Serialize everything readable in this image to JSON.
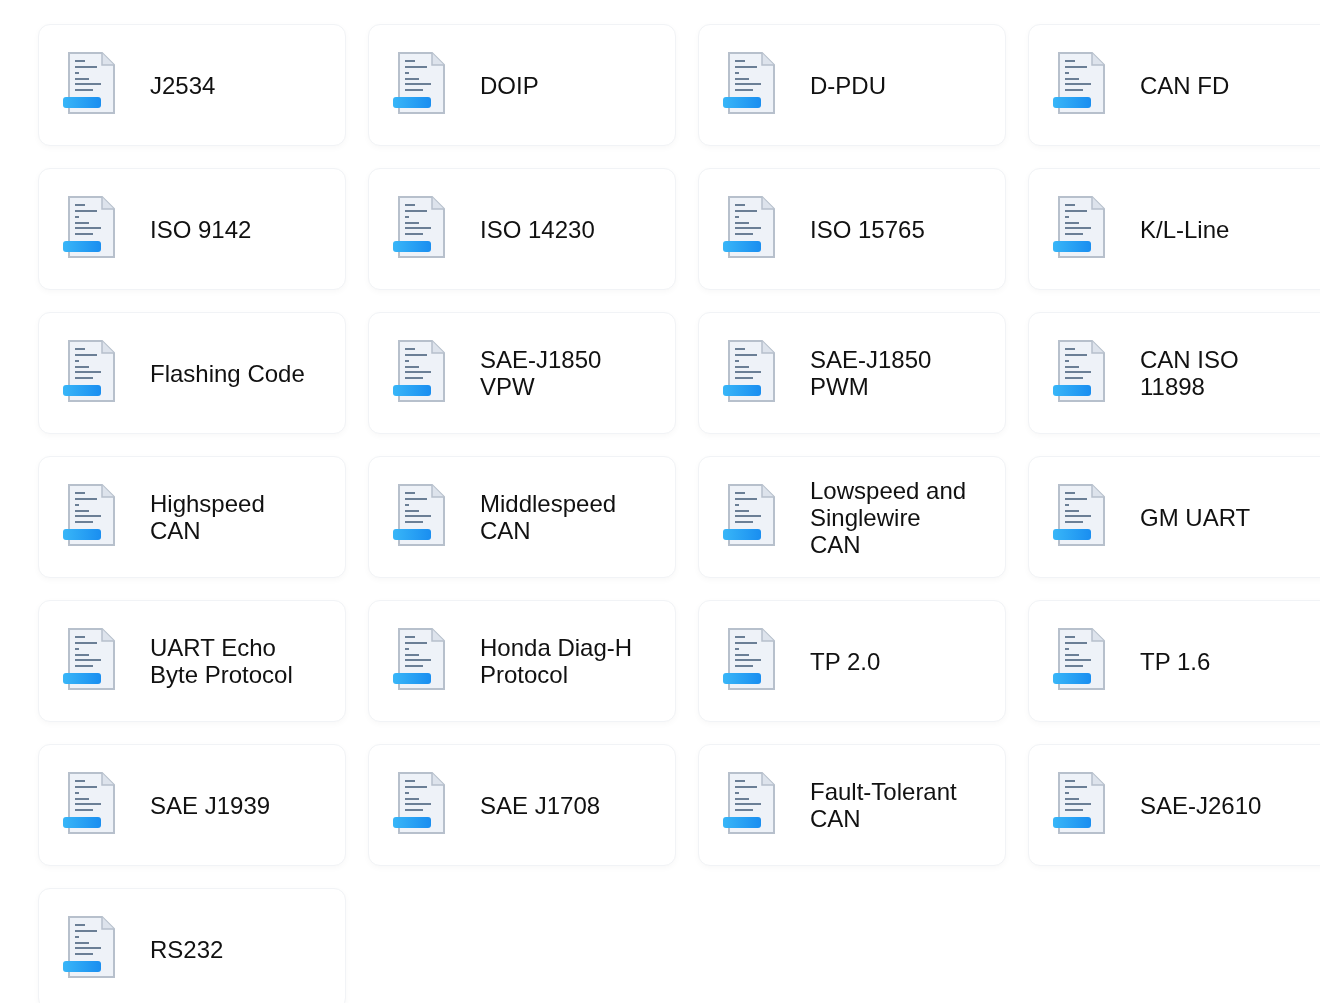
{
  "cards": [
    {
      "lines": [
        "J2534"
      ]
    },
    {
      "lines": [
        "DOIP"
      ]
    },
    {
      "lines": [
        "D-PDU"
      ]
    },
    {
      "lines": [
        "CAN FD"
      ]
    },
    {
      "lines": [
        "ISO 9142"
      ]
    },
    {
      "lines": [
        "ISO 14230"
      ]
    },
    {
      "lines": [
        "ISO 15765"
      ]
    },
    {
      "lines": [
        "K/L-Line"
      ]
    },
    {
      "lines": [
        "Flashing Code"
      ]
    },
    {
      "lines": [
        "SAE-J1850",
        "VPW"
      ]
    },
    {
      "lines": [
        "SAE-J1850",
        "PWM"
      ]
    },
    {
      "lines": [
        "CAN ISO",
        "11898"
      ]
    },
    {
      "lines": [
        "Highspeed",
        "CAN"
      ]
    },
    {
      "lines": [
        "Middlespeed",
        "CAN"
      ]
    },
    {
      "lines": [
        "Lowspeed and",
        "Singlewire",
        "CAN"
      ]
    },
    {
      "lines": [
        "GM UART"
      ]
    },
    {
      "lines": [
        "UART Echo",
        "Byte Protocol"
      ]
    },
    {
      "lines": [
        "Honda Diag-H",
        "Protocol"
      ]
    },
    {
      "lines": [
        "TP 2.0"
      ]
    },
    {
      "lines": [
        "TP 1.6"
      ]
    },
    {
      "lines": [
        "SAE J1939"
      ]
    },
    {
      "lines": [
        "SAE J1708"
      ]
    },
    {
      "lines": [
        "Fault-Tolerant",
        "CAN"
      ]
    },
    {
      "lines": [
        "SAE-J2610"
      ]
    },
    {
      "lines": [
        "RS232"
      ]
    }
  ]
}
